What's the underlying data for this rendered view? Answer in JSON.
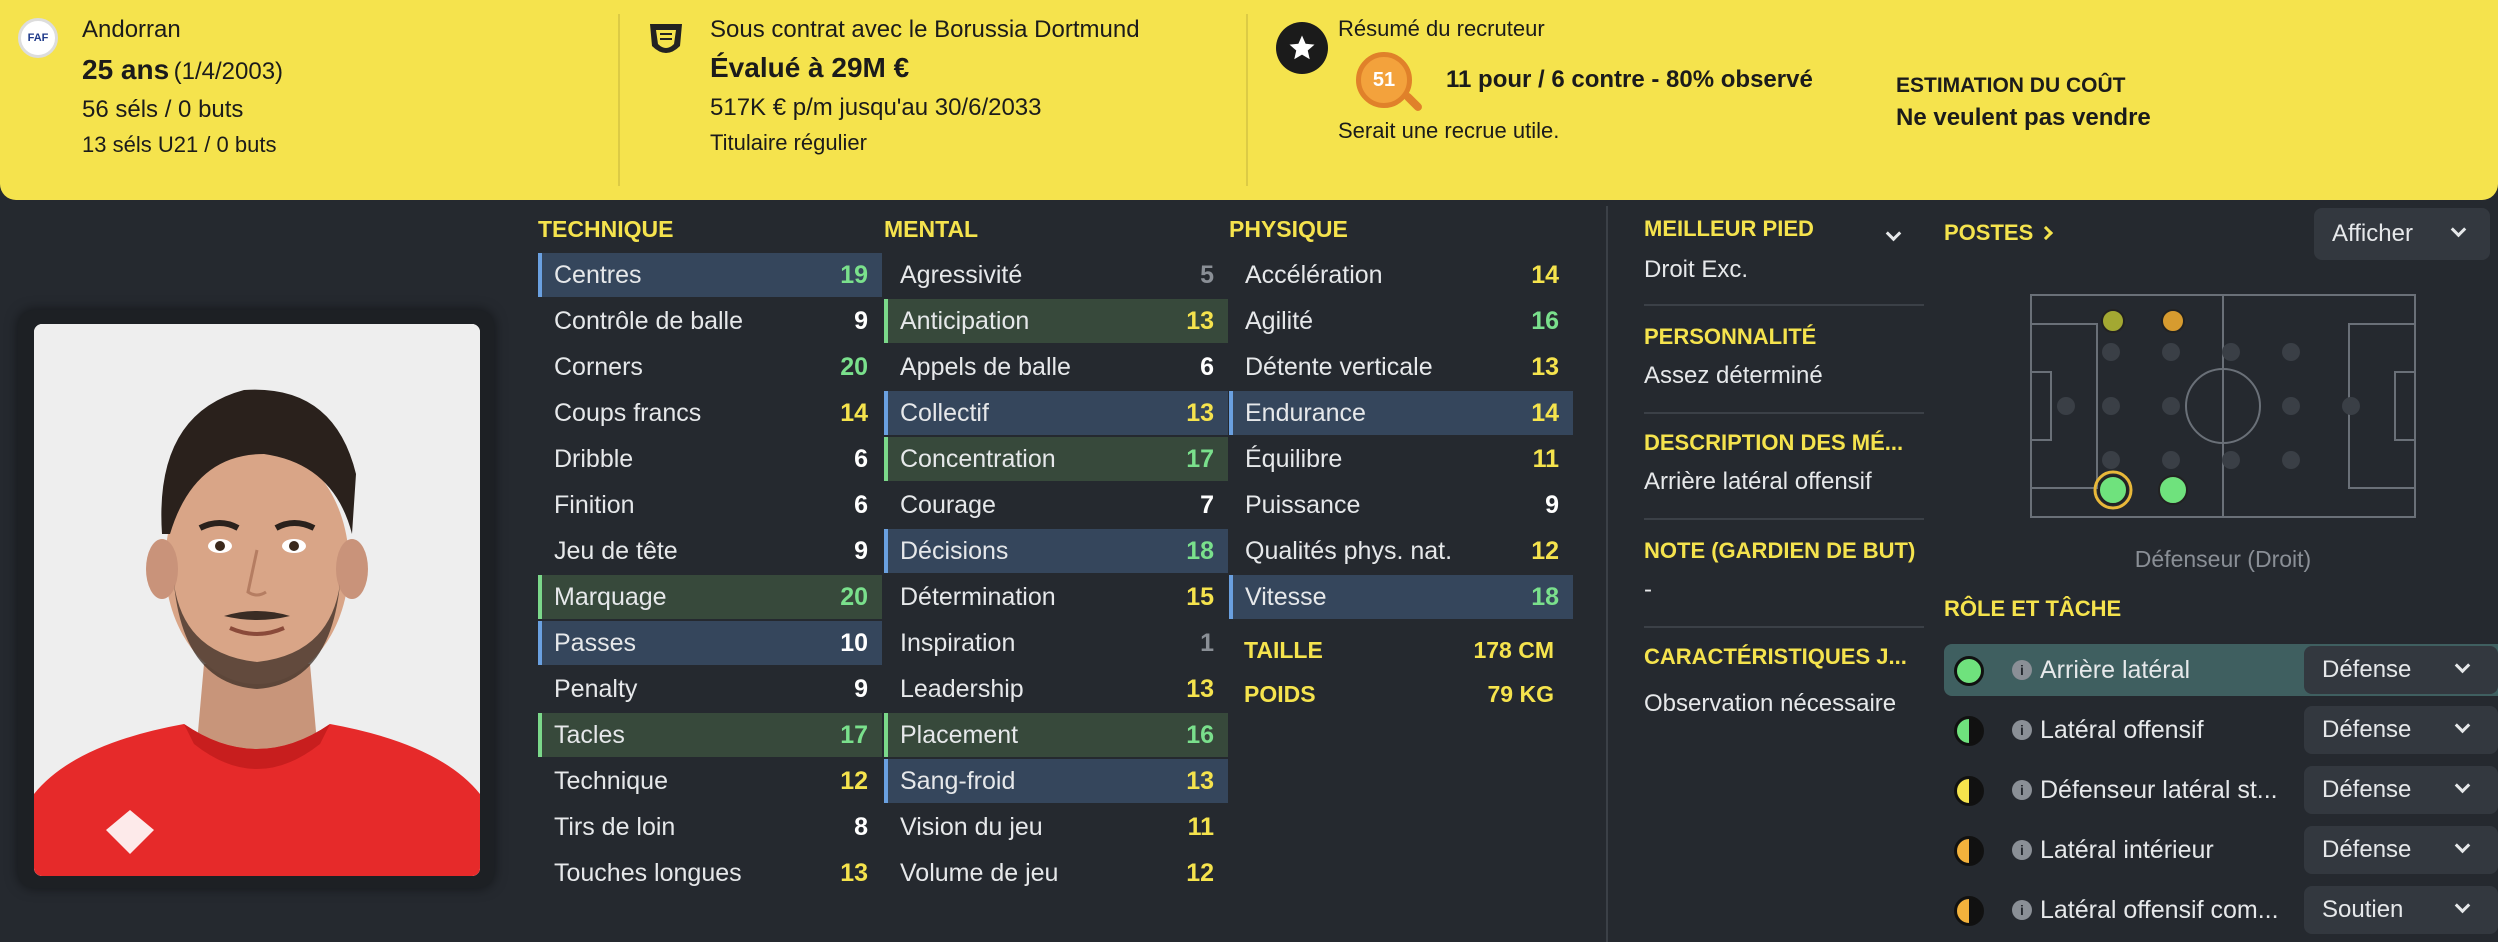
{
  "banner": {
    "nationality": "Andorran",
    "age": "25 ans",
    "dob": "(1/4/2003)",
    "caps": "56 séls / 0 buts",
    "u21_caps": "13 séls U21 / 0 buts",
    "contract": "Sous contrat avec le Borussia Dortmund",
    "value": "Évalué à 29M €",
    "wage": "517K € p/m jusqu'au 30/6/2033",
    "squad_status": "Titulaire régulier",
    "scout_title": "Résumé du recruteur",
    "scout_score": "51",
    "scout_summary": "11 pour / 6 contre - 80% observé",
    "scout_verdict": "Serait une recrue utile.",
    "cost_label": "ESTIMATION DU COÛT",
    "cost_value": "Ne veulent pas vendre",
    "colors": {
      "banner": "#f5e34d",
      "scout": "#f3a23c"
    }
  },
  "attributes": {
    "technique": {
      "title": "TECHNIQUE",
      "items": [
        {
          "label": "Centres",
          "value": "19"
        },
        {
          "label": "Contrôle de balle",
          "value": "9"
        },
        {
          "label": "Corners",
          "value": "20"
        },
        {
          "label": "Coups francs",
          "value": "14"
        },
        {
          "label": "Dribble",
          "value": "6"
        },
        {
          "label": "Finition",
          "value": "6"
        },
        {
          "label": "Jeu de tête",
          "value": "9"
        },
        {
          "label": "Marquage",
          "value": "20"
        },
        {
          "label": "Passes",
          "value": "10"
        },
        {
          "label": "Penalty",
          "value": "9"
        },
        {
          "label": "Tacles",
          "value": "17"
        },
        {
          "label": "Technique",
          "value": "12"
        },
        {
          "label": "Tirs de loin",
          "value": "8"
        },
        {
          "label": "Touches longues",
          "value": "13"
        }
      ]
    },
    "mental": {
      "title": "MENTAL",
      "items": [
        {
          "label": "Agressivité",
          "value": "5"
        },
        {
          "label": "Anticipation",
          "value": "13"
        },
        {
          "label": "Appels de balle",
          "value": "6"
        },
        {
          "label": "Collectif",
          "value": "13"
        },
        {
          "label": "Concentration",
          "value": "17"
        },
        {
          "label": "Courage",
          "value": "7"
        },
        {
          "label": "Décisions",
          "value": "18"
        },
        {
          "label": "Détermination",
          "value": "15"
        },
        {
          "label": "Inspiration",
          "value": "1"
        },
        {
          "label": "Leadership",
          "value": "13"
        },
        {
          "label": "Placement",
          "value": "16"
        },
        {
          "label": "Sang-froid",
          "value": "13"
        },
        {
          "label": "Vision du jeu",
          "value": "11"
        },
        {
          "label": "Volume de jeu",
          "value": "12"
        }
      ]
    },
    "physique": {
      "title": "PHYSIQUE",
      "items": [
        {
          "label": "Accélération",
          "value": "14"
        },
        {
          "label": "Agilité",
          "value": "16"
        },
        {
          "label": "Détente verticale",
          "value": "13"
        },
        {
          "label": "Endurance",
          "value": "14"
        },
        {
          "label": "Équilibre",
          "value": "11"
        },
        {
          "label": "Puissance",
          "value": "9"
        },
        {
          "label": "Qualités phys. nat.",
          "value": "12"
        },
        {
          "label": "Vitesse",
          "value": "18"
        }
      ],
      "height_label": "TAILLE",
      "height_value": "178 CM",
      "weight_label": "POIDS",
      "weight_value": "79 KG"
    }
  },
  "info": {
    "foot_label": "MEILLEUR PIED",
    "foot_value": "Droit Exc.",
    "personality_label": "PERSONNALITÉ",
    "personality_value": "Assez déterminé",
    "media_label": "DESCRIPTION DES MÉ...",
    "media_value": "Arrière latéral offensif",
    "gk_label": "NOTE (GARDIEN DE BUT)",
    "gk_value": "-",
    "traits_label": "CARACTÉRISTIQUES J...",
    "traits_value": "Observation nécessaire"
  },
  "positions": {
    "title": "POSTES",
    "toggle_label": "Afficher",
    "caption": "Défenseur (Droit)"
  },
  "roles": {
    "title": "RÔLE ET TÂCHE",
    "items": [
      {
        "name": "Arrière latéral",
        "duty": "Défense"
      },
      {
        "name": "Latéral offensif",
        "duty": "Défense"
      },
      {
        "name": "Défenseur latéral st...",
        "duty": "Défense"
      },
      {
        "name": "Latéral intérieur",
        "duty": "Défense"
      },
      {
        "name": "Latéral offensif com...",
        "duty": "Soutien"
      }
    ]
  }
}
